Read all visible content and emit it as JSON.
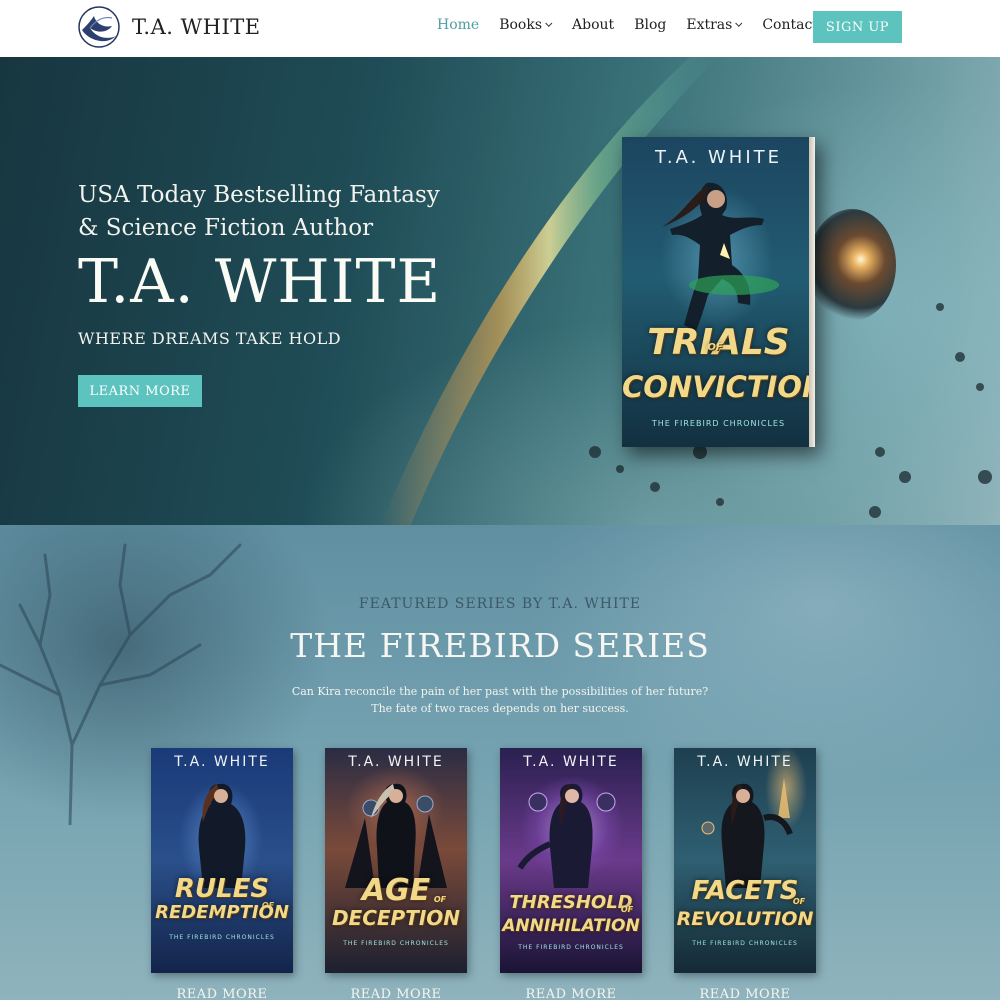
{
  "header": {
    "logo_text": "T.A. WHITE",
    "nav": [
      {
        "label": "Home",
        "active": true,
        "dropdown": false
      },
      {
        "label": "Books",
        "active": false,
        "dropdown": true
      },
      {
        "label": "About",
        "active": false,
        "dropdown": false
      },
      {
        "label": "Blog",
        "active": false,
        "dropdown": false
      },
      {
        "label": "Extras",
        "active": false,
        "dropdown": true
      },
      {
        "label": "Contact",
        "active": false,
        "dropdown": false
      }
    ],
    "signup_label": "SIGN UP"
  },
  "hero": {
    "subtitle": "USA Today Bestselling Fantasy & Science Fiction Author",
    "title": "T.A. WHITE",
    "tagline": "WHERE DREAMS TAKE HOLD",
    "cta_label": "LEARN MORE",
    "book": {
      "author": "T.A. WHITE",
      "title_line1": "TRIALS",
      "title_of": "OF",
      "title_line2": "CONVICTION",
      "series": "THE FIREBIRD CHRONICLES"
    }
  },
  "series": {
    "kicker": "FEATURED SERIES BY T.A. WHITE",
    "title": "THE FIREBIRD SERIES",
    "desc_line1": "Can Kira reconcile the pain of her past with the possibilities of her future?",
    "desc_line2": "The fate of two races depends on her success.",
    "read_more_label": "READ MORE",
    "books": [
      {
        "author": "T.A. WHITE",
        "title_line1": "RULES",
        "title_of": "OF",
        "title_line2": "REDEMPTION",
        "series": "THE FIREBIRD CHRONICLES",
        "theme": "#2a4f8a"
      },
      {
        "author": "T.A. WHITE",
        "title_line1": "AGE",
        "title_of": "OF",
        "title_line2": "DECEPTION",
        "series": "THE FIREBIRD CHRONICLES",
        "theme": "#7a4a3a"
      },
      {
        "author": "T.A. WHITE",
        "title_line1": "THRESHOLD",
        "title_of": "OF",
        "title_line2": "ANNIHILATION",
        "series": "THE FIREBIRD CHRONICLES",
        "theme": "#6a3a8a"
      },
      {
        "author": "T.A. WHITE",
        "title_line1": "FACETS",
        "title_of": "OF",
        "title_line2": "REVOLUTION",
        "series": "THE FIREBIRD CHRONICLES",
        "theme": "#2f5f72"
      }
    ]
  },
  "colors": {
    "accent": "#5cc3bf",
    "nav_active": "#4f9ea2",
    "book_title_gold": "#f2d98a"
  }
}
